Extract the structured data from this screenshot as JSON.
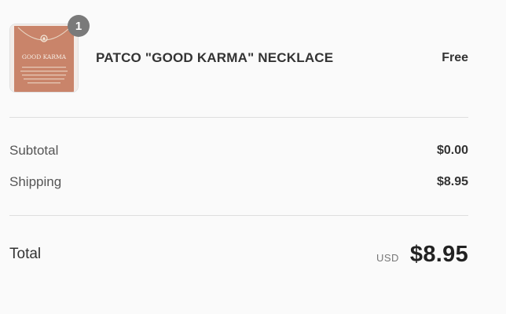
{
  "product": {
    "name": "PATCO \"GOOD KARMA\" NECKLACE",
    "price": "Free",
    "quantity": "1",
    "image_icon": "necklace-card-image",
    "card_text": "GOOD KARMA"
  },
  "summary": {
    "subtotal_label": "Subtotal",
    "subtotal_value": "$0.00",
    "shipping_label": "Shipping",
    "shipping_value": "$8.95"
  },
  "total": {
    "label": "Total",
    "currency": "USD",
    "value": "$8.95"
  },
  "colors": {
    "card": "#c9846a",
    "badge": "#7a7a7a",
    "divider": "#dedede"
  }
}
